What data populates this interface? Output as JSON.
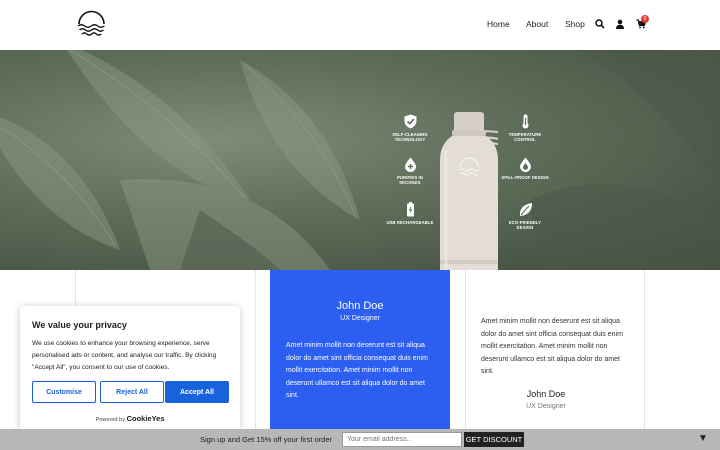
{
  "header": {
    "nav": [
      {
        "label": "Home"
      },
      {
        "label": "About"
      },
      {
        "label": "Shop"
      }
    ],
    "icons": [
      "search-icon",
      "user-icon",
      "cart-icon"
    ],
    "cart_count": "0"
  },
  "hero": {
    "features_left": [
      {
        "label": "SELF-CLEANING TECHNOLOGY",
        "icon": "shield-check-icon"
      },
      {
        "label": "PURIFIES IN SECONDS",
        "icon": "drop-plus-icon"
      },
      {
        "label": "USB RECHARGEABLE",
        "icon": "battery-icon"
      }
    ],
    "features_right": [
      {
        "label": "TEMPERATURE CONTROL",
        "icon": "thermometer-icon"
      },
      {
        "label": "SPILL-PROOF DESIGN",
        "icon": "drop-shield-icon"
      },
      {
        "label": "ECO-FRIENDLY DESIGN",
        "icon": "leaf-icon"
      }
    ]
  },
  "testimonials": {
    "featured": {
      "name": "John Doe",
      "role": "UX Designer",
      "quote": "Amet minim mollit non deserunt est sit aliqua dolor do amet sint officia consequat duis enim mollit exercitation. Amet minim mollit non deserunt ullamco est sit aliqua dolor do amet sint."
    },
    "right": {
      "name": "John Doe",
      "role": "UX Designer",
      "quote": "Amet minim mollit non deserunt est sit aliqua dolor do amet sint officia consequat duis enim mollit exercitation. Amet minim mollit non deserunt ullamco est sit aliqua dolor do amet sint."
    }
  },
  "cookie": {
    "title": "We value your privacy",
    "text": "We use cookies to enhance your browsing experience, serve personalised ads or content, and analyse our traffic. By clicking \"Accept All\", you consent to our use of cookies.",
    "customise": "Customise",
    "reject": "Reject All",
    "accept": "Accept All",
    "powered_by": "Powered by",
    "brand": "CookieYes"
  },
  "bottom_bar": {
    "promo": "Sign up and Get 15% off your first order",
    "email_placeholder": "Your email address..",
    "button": "GET DISCOUNT",
    "collapse": "▼"
  },
  "colors": {
    "accent_blue": "#2b5ef1",
    "cookie_blue": "#1863dc",
    "badge_red": "#e53935"
  }
}
